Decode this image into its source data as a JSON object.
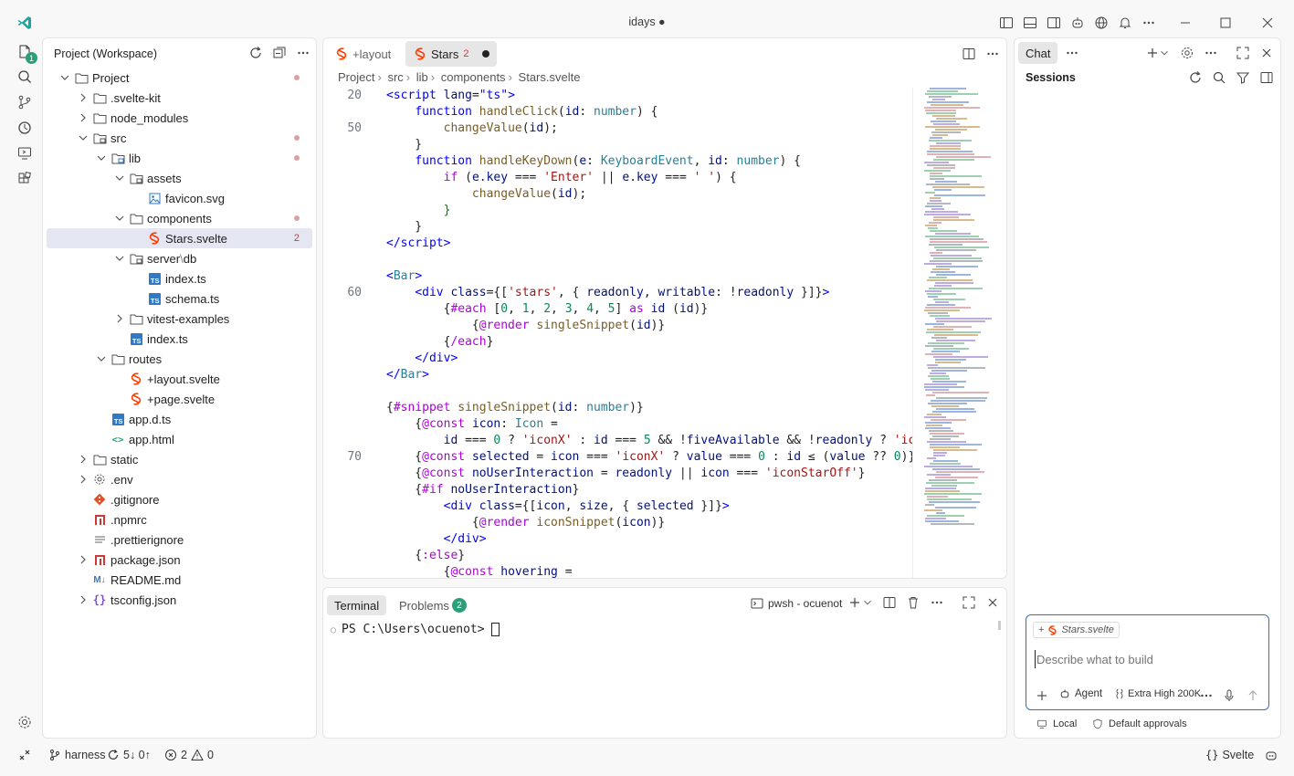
{
  "window": {
    "title": "idays ●"
  },
  "activity": {
    "badge": "1"
  },
  "explorer": {
    "title": "Project (Workspace)",
    "rows": [
      {
        "label": "Project",
        "count": ""
      },
      {
        "label": ".svelte-kit",
        "count": ""
      },
      {
        "label": "node_modules",
        "count": ""
      },
      {
        "label": "src",
        "count": ""
      },
      {
        "label": "lib",
        "count": ""
      },
      {
        "label": "assets",
        "count": ""
      },
      {
        "label": "favicon.svg",
        "count": ""
      },
      {
        "label": "components",
        "count": ""
      },
      {
        "label": "Stars.svelte",
        "count": "2"
      },
      {
        "label": "server",
        "count": ""
      },
      {
        "label": "index.ts",
        "count": ""
      },
      {
        "label": "schema.ts",
        "count": ""
      },
      {
        "label": "vitest-examples",
        "count": ""
      },
      {
        "label": "index.ts",
        "count": ""
      },
      {
        "label": "routes",
        "count": ""
      },
      {
        "label": "+layout.svelte",
        "count": ""
      },
      {
        "label": "+page.svelte",
        "count": ""
      },
      {
        "label": "app.d.ts",
        "count": ""
      },
      {
        "label": "app.html",
        "count": ""
      },
      {
        "label": "static",
        "count": ""
      },
      {
        "label": ".env",
        "count": ""
      },
      {
        "label": ".gitignore",
        "count": ""
      },
      {
        "label": ".npmrc",
        "count": ""
      },
      {
        "label": ".prettierignore",
        "count": ""
      },
      {
        "label": "package.json",
        "count": ""
      },
      {
        "label": "README.md",
        "count": ""
      },
      {
        "label": "tsconfig.json",
        "count": ""
      }
    ],
    "server_suffix": "db"
  },
  "editor": {
    "tabs": [
      {
        "label": "+layout"
      },
      {
        "label": "Stars",
        "count": "2"
      }
    ],
    "breadcrumbs": [
      "Project",
      "src",
      "lib",
      "components",
      "Stars.svelte"
    ],
    "line_numbers": [
      "20",
      "50",
      "60",
      "70"
    ]
  },
  "terminal": {
    "tab_terminal": "Terminal",
    "tab_problems": "Problems",
    "problems_count": "2",
    "shell": "pwsh - ocuenot",
    "prompt": "PS C:\\Users\\ocuenot> "
  },
  "chat": {
    "tab": "Chat",
    "sessions": "Sessions",
    "context_file": "Stars.svelte",
    "placeholder": "Describe what to build",
    "agent": "Agent",
    "model": "Extra High 200K",
    "local": "Local",
    "approvals": "Default approvals"
  },
  "status": {
    "branch": "harness",
    "sync": "5↓ 0↑",
    "errors": "2",
    "warnings": "0",
    "language": "Svelte"
  },
  "colors": {
    "accent": "#2f6fce",
    "svelte": "#ff3e00",
    "ts": "#3178c6",
    "badge": "#2c9f79"
  }
}
